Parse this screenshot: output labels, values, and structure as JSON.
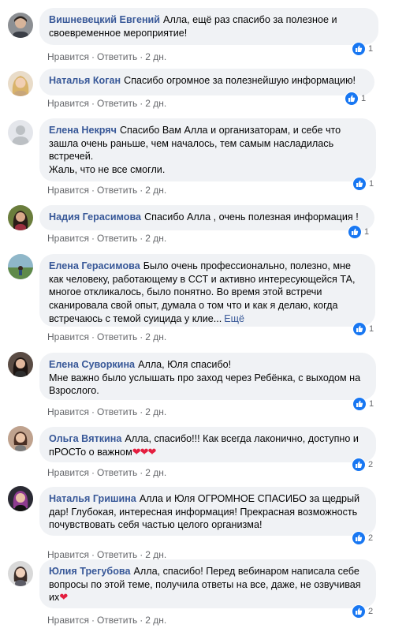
{
  "actions": {
    "like": "Нравится",
    "reply": "Ответить",
    "time": "2 дн.",
    "sep": "·"
  },
  "colors": {
    "bubble": "#f0f2f5",
    "name": "#385898",
    "like_blue": "#1877f2",
    "meta": "#65676b"
  },
  "comments": [
    {
      "author": "Вишневецкий Евгений",
      "text": "Алла, ещё раз спасибо за полезное и\nсвоевременное мероприятие!",
      "likes": "1",
      "avatar": "man-dark-hair"
    },
    {
      "author": "Наталья Коган",
      "text": "Спасибо огромное за полезнейшую информацию!",
      "likes": "1",
      "avatar": "woman-blonde"
    },
    {
      "author": "Елена Некряч",
      "text": "Спасибо Вам Алла и организаторам, и себе что\nзашла очень раньше, чем началось, тем самым насладилась\nвстречей.\nЖаль, что не все смогли.",
      "likes": "1",
      "avatar": "default-silhouette"
    },
    {
      "author": "Надия Герасимова",
      "text": "Спасибо Алла , очень полезная информация !",
      "likes": "1",
      "avatar": "woman-dark-hair"
    },
    {
      "author": "Елена Герасимова",
      "text": "Было очень профессионально, полезно, мне\nкак человеку, работающему в ССТ и активно интересующейся ТА,\nмногое откликалось, было понятно. Во время этой встречи\nсканировала свой опыт, думала о том что и как я делаю, когда\nвстречаюсь с темой суицида у клие...",
      "more": "Ещё",
      "likes": "1",
      "avatar": "landscape-photo"
    },
    {
      "author": "Елена Суворкина",
      "text": "Алла, Юля спасибо!\nМне важно было услышать про заход через Ребёнка, с выходом на\nВзрослого.",
      "likes": "1",
      "avatar": "woman-dark-hair-2"
    },
    {
      "author": "Ольга Вяткина",
      "text": "Алла, спасибо!!! Как всегда лаконично, доступно и\nпРОСТо о важном",
      "hearts": "❤❤❤",
      "likes": "2",
      "avatar": "woman-short-hair"
    },
    {
      "author": "Наталья Гришина",
      "text": "Алла и Юля ОГРОМНОЕ СПАСИБО за щедрый\nдар! Глубокая, интересная информация! Прекрасная возможность\nпочувствовать себя частью целого организма!",
      "likes": "2",
      "avatar": "woman-pink-hair"
    },
    {
      "author": "Юлия Трегубова",
      "text": "Алла, спасибо! Перед вебинаром написала себе\nвопросы по этой теме, получила ответы на все, даже, не озвучивая\nих",
      "hearts": "❤",
      "likes": "2",
      "avatar": "woman-portrait"
    }
  ]
}
